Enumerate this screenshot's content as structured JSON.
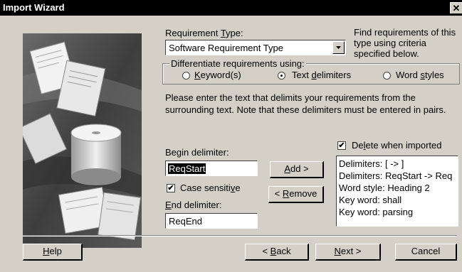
{
  "window": {
    "title": "Import Wizard",
    "close_glyph": "✕"
  },
  "requirement_type": {
    "label_pre": "Requirement ",
    "label_key": "T",
    "label_post": "ype:",
    "selected": "Software Requirement Type"
  },
  "help_text": "Find requirements of this type using criteria specified below.",
  "differentiate": {
    "legend": "Differentiate requirements using:",
    "options": [
      {
        "key": "K",
        "rest": "eyword(s)",
        "pre": "",
        "selected": false
      },
      {
        "pre": "Text ",
        "key": "d",
        "rest": "elimiters",
        "selected": true
      },
      {
        "pre": "Word ",
        "key": "s",
        "rest": "tyles",
        "selected": false
      }
    ]
  },
  "instructions": "Please enter the text that delimits your requirements from the surrounding text.  Note that these delimiters must be entered in pairs.",
  "begin_delimiter": {
    "label": "Begin delimiter:",
    "value": "ReqStart"
  },
  "case_sensitive": {
    "pre": "Case sensiti",
    "key": "v",
    "post": "e",
    "checked": true
  },
  "end_delimiter": {
    "key": "E",
    "rest": "nd delimiter:",
    "value": "ReqEnd"
  },
  "add_button": {
    "key": "A",
    "rest": "dd >"
  },
  "remove_button": {
    "pre": "< ",
    "key": "R",
    "rest": "emove"
  },
  "delete_when_imported": {
    "pre": "De",
    "key": "l",
    "post": "ete when imported",
    "checked": true
  },
  "criteria_list": [
    "Delimiters: [ -> ]",
    "Delimiters: ReqStart -> Req",
    "Word style: Heading 2",
    "Key word: shall",
    "Key word: parsing"
  ],
  "footer": {
    "help": {
      "key": "H",
      "rest": "elp"
    },
    "back": {
      "pre": "< ",
      "key": "B",
      "rest": "ack"
    },
    "next": {
      "key": "N",
      "rest": "ext >"
    },
    "cancel": "Cancel"
  }
}
